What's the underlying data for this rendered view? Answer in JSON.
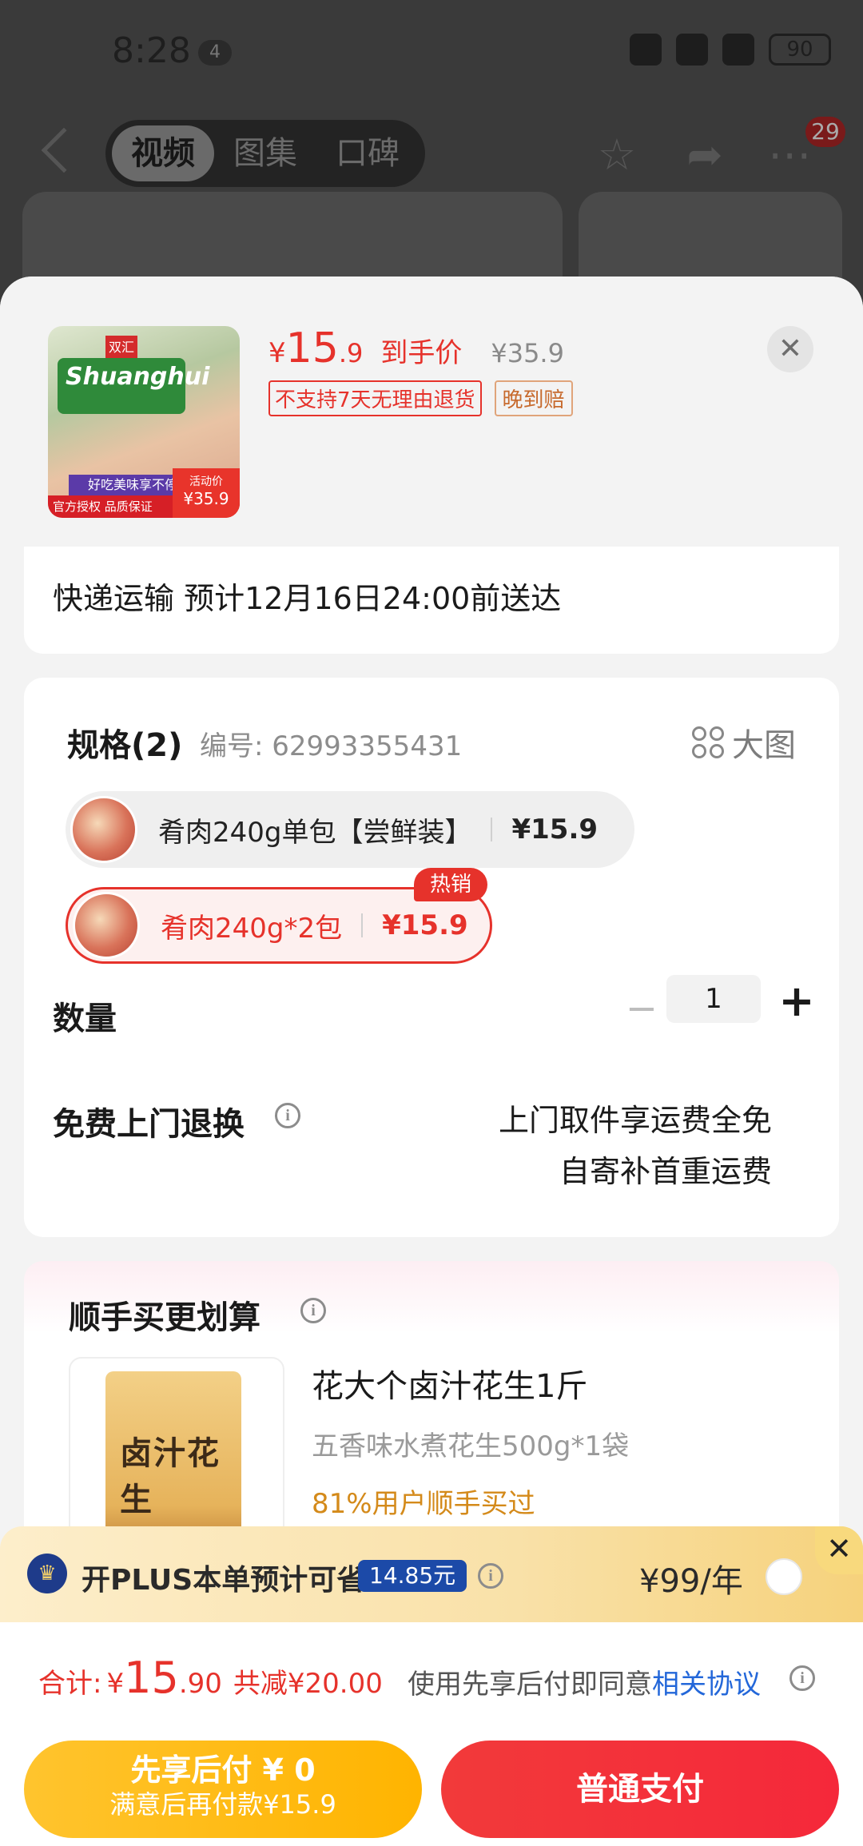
{
  "status_bar": {
    "time": "8:28",
    "notif_count": "4",
    "battery": "90"
  },
  "nav": {
    "tabs": [
      "视频",
      "图集",
      "口碑"
    ],
    "badge": "29"
  },
  "product": {
    "thumb": {
      "brand": "Shuanghui",
      "logo": "双汇",
      "ribbon": "好吃美味享不停",
      "bottom_tags": "官方授权  品质保证",
      "promo_label": "活动价",
      "promo_price": "¥35.9"
    },
    "price": {
      "symbol": "¥",
      "integer": "15",
      "decimal": ".9",
      "label": "到手价",
      "original": "¥35.9"
    },
    "tags": {
      "no_return": "不支持7天无理由退货",
      "late_comp": "晚到赔"
    },
    "close_glyph": "✕"
  },
  "shipping": {
    "text": "快递运输 预计12月16日24:00前送达"
  },
  "spec": {
    "title": "规格(2)",
    "code": "编号: 62993355431",
    "big_image": "大图",
    "variants": [
      {
        "name": "肴肉240g单包【尝鲜装】",
        "price": "¥15.9"
      },
      {
        "name": "肴肉240g*2包",
        "price": "¥15.9",
        "badge": "热销"
      }
    ],
    "quantity_label": "数量",
    "quantity": "1",
    "minus": "−",
    "plus": "+",
    "return_label": "免费上门退换",
    "return_line1": "上门取件享运费全免",
    "return_line2": "自寄补首重运费"
  },
  "upsell": {
    "title": "顺手买更划算",
    "bag_text": "卤汁花生",
    "name": "花大个卤汁花生1斤",
    "sub": "五香味水煮花生500g*1袋",
    "stat": "81%用户顺手买过"
  },
  "plus": {
    "text": "开PLUS本单预计可省",
    "save": "14.85元",
    "price": "¥99/年",
    "close": "✕"
  },
  "total": {
    "label": "合计:",
    "symbol": "¥",
    "integer": "15",
    "decimal": ".90",
    "saving": "共减¥20.00",
    "agree_prefix": "使用先享后付即同意",
    "agree_link": "相关协议"
  },
  "buttons": {
    "later_line1": "先享后付 ¥ 0",
    "later_line2": "满意后再付款¥15.9",
    "pay": "普通支付"
  },
  "info_glyph": "i"
}
